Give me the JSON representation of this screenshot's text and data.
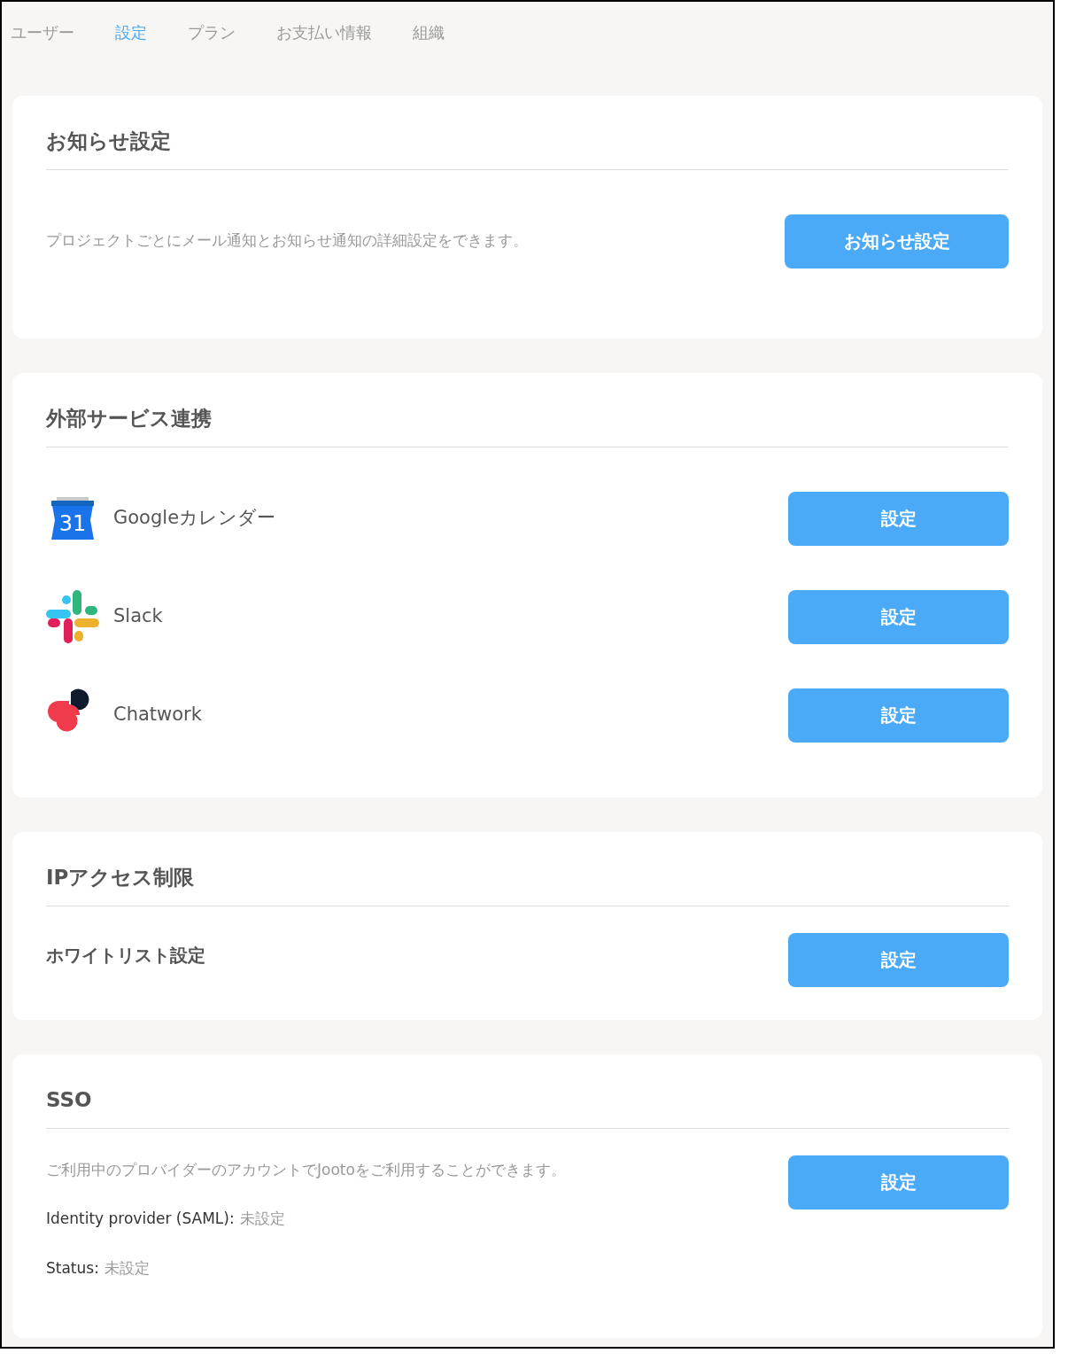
{
  "tabs": [
    {
      "label": "ユーザー",
      "selected": false
    },
    {
      "label": "設定",
      "selected": true
    },
    {
      "label": "プラン",
      "selected": false
    },
    {
      "label": "お支払い情報",
      "selected": false
    },
    {
      "label": "組織",
      "selected": false
    }
  ],
  "notifications": {
    "title": "お知らせ設定",
    "description": "プロジェクトごとにメール通知とお知らせ通知の詳細設定をできます。",
    "button": "お知らせ設定"
  },
  "integrations": {
    "title": "外部サービス連携",
    "services": [
      {
        "kind": "calendar",
        "icon_text": "31",
        "name": "Googleカレンダー",
        "button": "設定"
      },
      {
        "kind": "slack",
        "name": "Slack",
        "button": "設定"
      },
      {
        "kind": "chatwork",
        "name": "Chatwork",
        "button": "設定"
      }
    ]
  },
  "ip_access": {
    "title": "IPアクセス制限",
    "label": "ホワイトリスト設定",
    "button": "設定"
  },
  "sso": {
    "title": "SSO",
    "description": "ご利用中のプロバイダーのアカウントでJootoをご利用することができます。",
    "button": "設定",
    "fields": [
      {
        "label": "Identity provider (SAML):",
        "value": "未設定"
      },
      {
        "label": "Status:",
        "value": "未設定"
      }
    ]
  }
}
